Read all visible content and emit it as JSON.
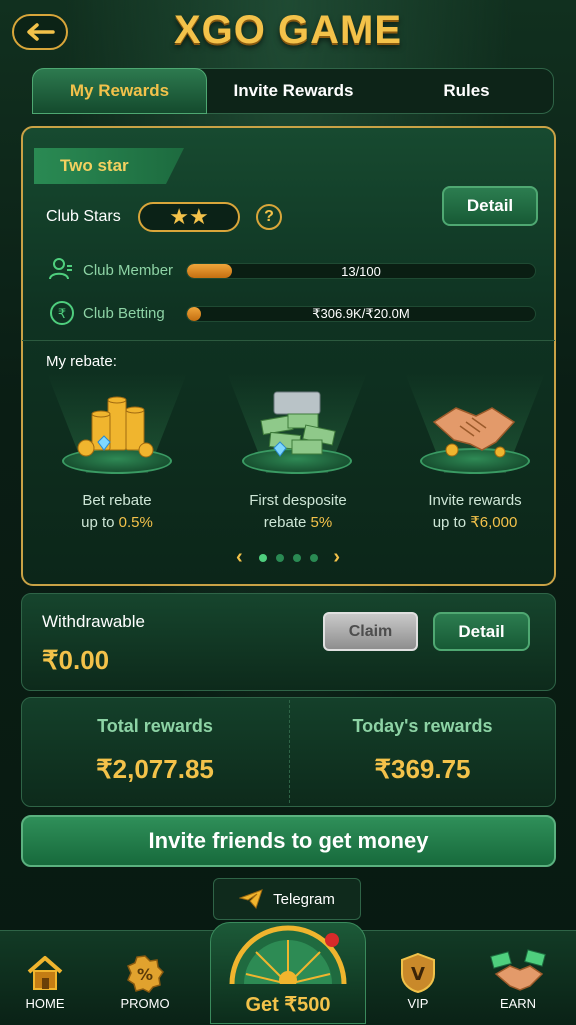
{
  "header": {
    "title": "XGO GAME",
    "back_icon": "back-arrow-icon"
  },
  "tabs": [
    {
      "label": "My Rewards",
      "active": true
    },
    {
      "label": "Invite Rewards",
      "active": false
    },
    {
      "label": "Rules",
      "active": false
    }
  ],
  "club": {
    "tier": "Two star",
    "stars_label": "Club Stars",
    "stars": "★★",
    "help": "?",
    "detail_button": "Detail",
    "member": {
      "label": "Club Member",
      "value": "13/100",
      "progress": 0.13
    },
    "betting": {
      "label": "Club Betting",
      "value": "₹306.9K/₹20.0M",
      "progress": 0.015
    },
    "rebate_title": "My rebate:",
    "rebates": [
      {
        "line1": "Bet rebate",
        "line2_prefix": "up to ",
        "line2_value": "0.5%"
      },
      {
        "line1": "First desposite",
        "line2_prefix": "rebate ",
        "line2_value": "5%"
      },
      {
        "line1": "Invite rewards",
        "line2_prefix": "up to ",
        "line2_value": "₹6,000"
      }
    ],
    "carousel": {
      "pages": 4,
      "active": 0
    }
  },
  "withdraw": {
    "label": "Withdrawable",
    "amount": "₹0.00",
    "claim_button": "Claim",
    "detail_button": "Detail"
  },
  "totals": {
    "total_label": "Total rewards",
    "total_value": "₹2,077.85",
    "today_label": "Today's rewards",
    "today_value": "₹369.75"
  },
  "invite_button": "Invite friends to get money",
  "telegram_button": "Telegram",
  "nav": {
    "home": "HOME",
    "promo": "PROMO",
    "center": "Get ₹500",
    "vip": "VIP",
    "earn": "EARN"
  },
  "colors": {
    "gold": "#f3c24a",
    "green": "#2c7d50",
    "bg": "#0a1d14"
  }
}
